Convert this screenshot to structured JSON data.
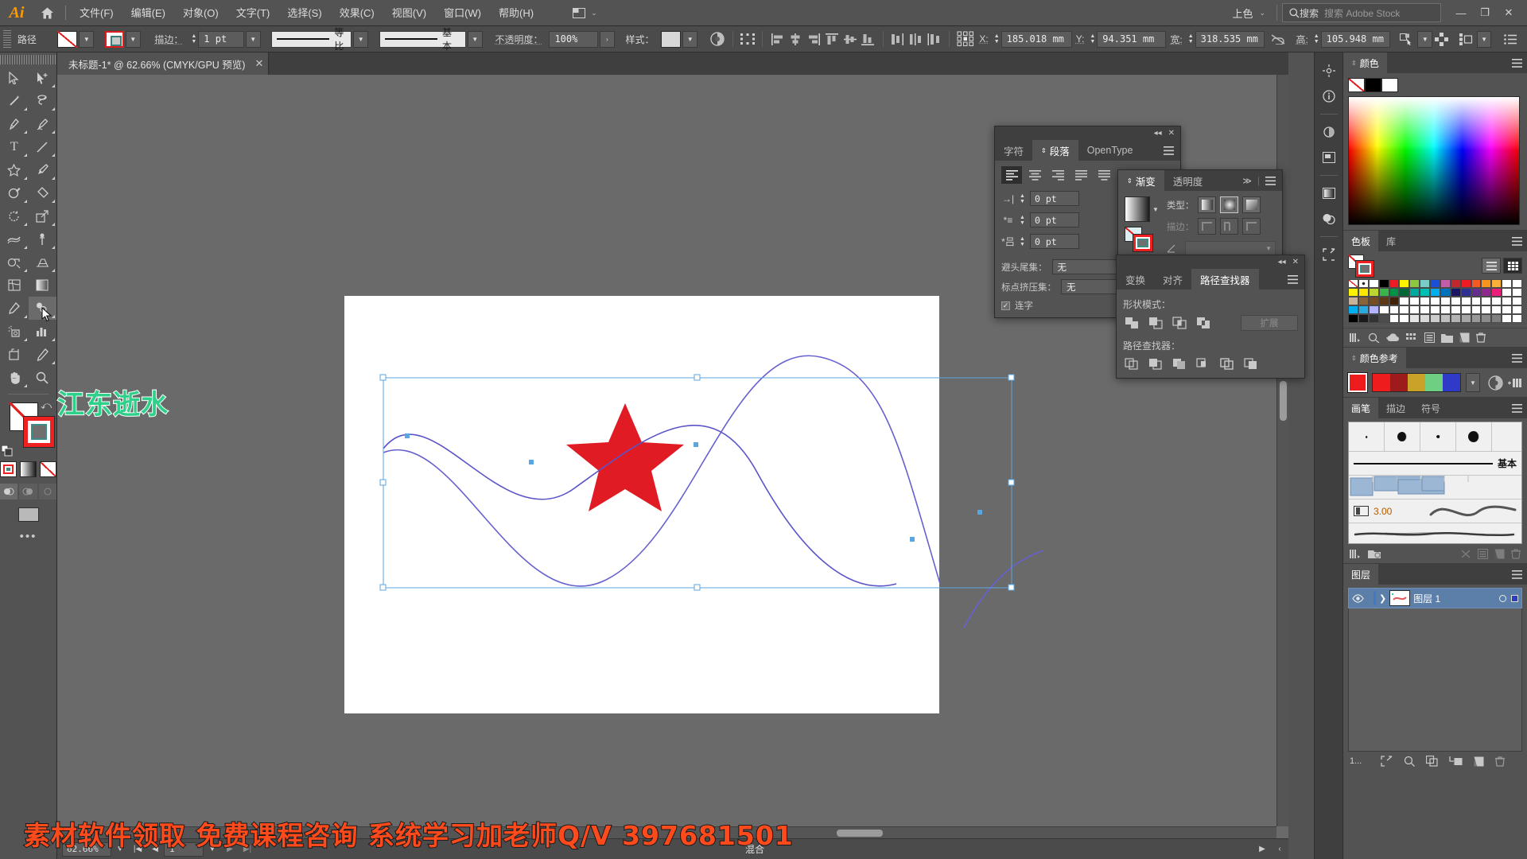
{
  "app": {
    "title": "Adobe Illustrator",
    "logo": "Ai"
  },
  "menubar": {
    "items": [
      "文件(F)",
      "编辑(E)",
      "对象(O)",
      "文字(T)",
      "选择(S)",
      "效果(C)",
      "视图(V)",
      "窗口(W)",
      "帮助(H)"
    ],
    "workspace_label": "上色",
    "search_placeholder": "搜索 Adobe Stock",
    "search_value": "搜索",
    "win_minimize": "—",
    "win_restore": "❐",
    "win_close": "✕"
  },
  "controlbar": {
    "object_label": "路径",
    "stroke_label": "描边：",
    "stroke_weight": "1 pt",
    "stroke_profile": "等比",
    "brush_definition": "基本",
    "opacity_label": "不透明度：",
    "opacity_value": "100%",
    "style_label": "样式：",
    "x_label": "X:",
    "x_value": "185.018 mm",
    "y_label": "Y:",
    "y_value": "94.351 mm",
    "w_label": "宽:",
    "w_value": "318.535 mm",
    "h_label": "高:",
    "h_value": "105.948 mm"
  },
  "tabbar": {
    "doc_tab": "未标题-1* @ 62.66% (CMYK/GPU 预览)",
    "close": "✕"
  },
  "toolbar": {
    "tools": [
      {
        "name": "selection-tool",
        "glyph": "▷"
      },
      {
        "name": "direct-selection-tool",
        "glyph": "▶"
      },
      {
        "name": "magic-wand-tool",
        "glyph": "✦"
      },
      {
        "name": "lasso-tool",
        "glyph": "◠"
      },
      {
        "name": "pen-tool",
        "glyph": "✒"
      },
      {
        "name": "curvature-tool",
        "glyph": "✑"
      },
      {
        "name": "type-tool",
        "glyph": "T"
      },
      {
        "name": "line-segment-tool",
        "glyph": "／"
      },
      {
        "name": "shape-tool",
        "glyph": "☆"
      },
      {
        "name": "paintbrush-tool",
        "glyph": "🖌"
      },
      {
        "name": "shaper-tool",
        "glyph": "◔"
      },
      {
        "name": "eraser-tool",
        "glyph": "◇"
      },
      {
        "name": "rotate-tool",
        "glyph": "↺"
      },
      {
        "name": "scale-tool",
        "glyph": "⬈"
      },
      {
        "name": "width-tool",
        "glyph": "≋"
      },
      {
        "name": "free-transform-tool",
        "glyph": "📌"
      },
      {
        "name": "shape-builder-tool",
        "glyph": "◉"
      },
      {
        "name": "perspective-grid-tool",
        "glyph": "▦"
      },
      {
        "name": "mesh-tool",
        "glyph": "▩"
      },
      {
        "name": "gradient-tool",
        "glyph": "▤"
      },
      {
        "name": "eyedropper-tool",
        "glyph": "🖉"
      },
      {
        "name": "blend-tool",
        "glyph": "❏"
      },
      {
        "name": "symbol-sprayer-tool",
        "glyph": "⁙"
      },
      {
        "name": "column-graph-tool",
        "glyph": "📊"
      },
      {
        "name": "artboard-tool",
        "glyph": "⌗"
      },
      {
        "name": "slice-tool",
        "glyph": "✎"
      },
      {
        "name": "hand-tool",
        "glyph": "✋"
      },
      {
        "name": "zoom-tool",
        "glyph": "🔍"
      }
    ],
    "active_tool": "blend-tool"
  },
  "canvas": {
    "artwork_text": "江东逝水",
    "star_color": "#e01b24",
    "path_color": "#5a54c8",
    "selection_color": "#5aa6e0",
    "artboard_color": "#ffffff"
  },
  "paragraph_panel": {
    "tabs": [
      "字符",
      "段落",
      "OpenType"
    ],
    "active_tab": "段落",
    "indent_left": "0 pt",
    "indent_first": "0 pt",
    "space_before": "0 pt",
    "indent_right": "0 pt",
    "space_after": "0 pt",
    "hanging_label": "避头尾集：",
    "hanging_value": "无",
    "burasagari_label": "标点挤压集：",
    "burasagari_value": "无",
    "hyphenate_label": "连字",
    "hyphenate_checked": true,
    "collapse": "◂◂",
    "close": "✕"
  },
  "gradient_panel": {
    "tabs": [
      "渐变",
      "透明度"
    ],
    "active_tab": "渐变",
    "type_label": "类型：",
    "stroke_label": "描边：",
    "more": "≫"
  },
  "pathfinder_panel": {
    "tabs": [
      "变换",
      "对齐",
      "路径查找器"
    ],
    "active_tab": "路径查找器",
    "shape_modes_label": "形状模式：",
    "pathfinders_label": "路径查找器：",
    "expand_label": "扩展",
    "collapse": "◂◂",
    "close": "✕"
  },
  "color_panel": {
    "tab": "颜色",
    "swatches": [
      "none",
      "#000000",
      "#ffffff"
    ]
  },
  "swatches_panel": {
    "tabs": [
      "色板",
      "库"
    ],
    "active_tab": "色板",
    "grid": [
      [
        "none",
        "reg",
        "#ffffff",
        "#000000",
        "#ed1c24",
        "#fff200",
        "#8dc63f",
        "#7accc8",
        "#1c4fd8",
        "#c05fa8",
        "#c1272d",
        "#ed1c24",
        "#f15a24",
        "#f7931e",
        "#fbb03b",
        "#ffffff",
        "#ffffff"
      ],
      [
        "#fff200",
        "#ffe600",
        "#bed630",
        "#39b54a",
        "#009245",
        "#006837",
        "#00a99d",
        "#00c0b5",
        "#00aeef",
        "#0071bc",
        "#1b1464",
        "#2e3192",
        "#662d91",
        "#92278f",
        "#ed1e79",
        "#ffffff",
        "#ffffff"
      ],
      [
        "#c7b299",
        "#8c6239",
        "#754c24",
        "#603813",
        "#42210b",
        "#ffffff",
        "#ffffff",
        "#ffffff",
        "#ffffff",
        "#ffffff",
        "#ffffff",
        "#ffffff",
        "#ffffff",
        "#ffffff",
        "#ffffff",
        "#ffffff",
        "#ffffff"
      ],
      [
        "#00aeef",
        "#29abe2",
        "#b3b3ff",
        "#ffffff",
        "#ffffff",
        "#ffffff",
        "#ffffff",
        "#ffffff",
        "#ffffff",
        "#ffffff",
        "#ffffff",
        "#ffffff",
        "#ffffff",
        "#ffffff",
        "#ffffff",
        "#ffffff",
        "#ffffff"
      ],
      [
        "#000000",
        "#1a1a1a",
        "#333333",
        "#4d4d4d",
        "#ffffff",
        "#ffffff",
        "#e6e6e6",
        "#d9d9d9",
        "#cccccc",
        "#bfbfbf",
        "#b3b3b3",
        "#a6a6a6",
        "#999999",
        "#8c8c8c",
        "#808080",
        "#ffffff",
        "#ffffff"
      ]
    ]
  },
  "color_guide_panel": {
    "tab": "颜色参考",
    "base_color": "#ee1c1c",
    "harmony": [
      "#ee1c1c",
      "#9e1b1b",
      "#c9a227",
      "#6ece82",
      "#2f3bc8"
    ]
  },
  "brushes_panel": {
    "tabs": [
      "画笔",
      "描边",
      "符号"
    ],
    "active_tab": "画笔",
    "basic_label": "基本",
    "size_value": "3.00"
  },
  "layers_panel": {
    "tab": "图层",
    "layer_name": "图层 1",
    "count_label": "1..."
  },
  "statusbar": {
    "zoom": "62.66%",
    "page_value": "1",
    "info": "混合"
  },
  "watermark": {
    "text": "素材软件领取  免费课程咨询  系统学习加老师Q/V  397681501"
  }
}
